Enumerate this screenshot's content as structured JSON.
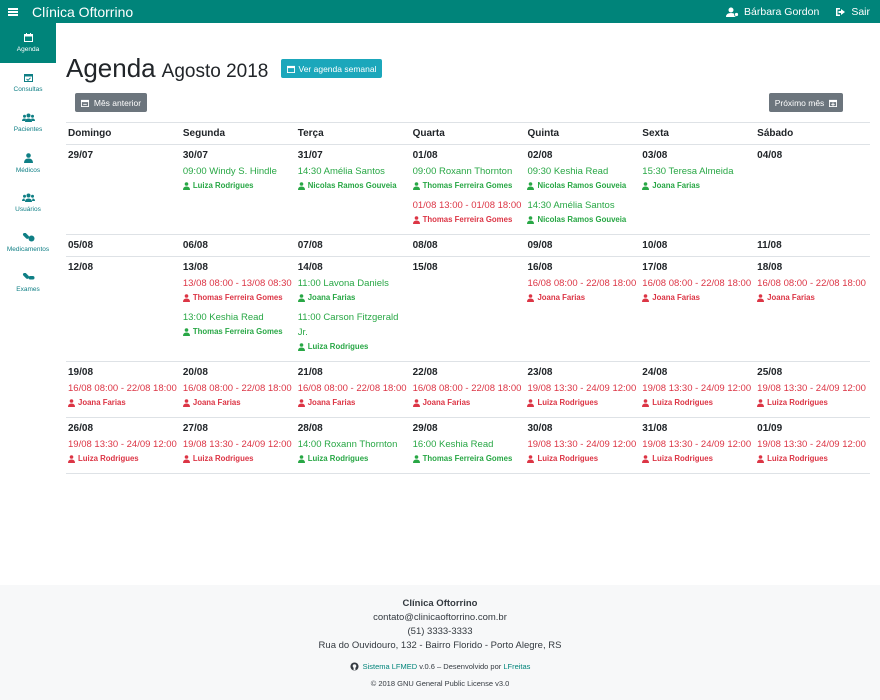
{
  "header": {
    "brand": "Clínica Oftorrino",
    "user": "Bárbara Gordon",
    "logout": "Sair"
  },
  "sidebar": {
    "items": [
      {
        "label": "Agenda",
        "icon": "calendar-icon",
        "active": true
      },
      {
        "label": "Consultas",
        "icon": "calendar-check-icon"
      },
      {
        "label": "Pacientes",
        "icon": "users-icon"
      },
      {
        "label": "Médicos",
        "icon": "doctor-icon"
      },
      {
        "label": "Usuários",
        "icon": "users-cog-icon"
      },
      {
        "label": "Medicamentos",
        "icon": "pills-icon"
      },
      {
        "label": "Exames",
        "icon": "capsules-icon"
      }
    ]
  },
  "page": {
    "title": "Agenda",
    "subtitle": "Agosto 2018",
    "week_button": "Ver agenda semanal",
    "prev_button": "Mês anterior",
    "next_button": "Próximo mês"
  },
  "calendar": {
    "days": [
      "Domingo",
      "Segunda",
      "Terça",
      "Quarta",
      "Quinta",
      "Sexta",
      "Sábado"
    ],
    "weeks": [
      [
        {
          "date": "29/07",
          "events": []
        },
        {
          "date": "30/07",
          "events": [
            {
              "text": "09:00 Windy S. Hindle",
              "doctor": "Luiza Rodrigues",
              "type": "green"
            }
          ]
        },
        {
          "date": "31/07",
          "events": [
            {
              "text": "14:30 Amélia Santos",
              "doctor": "Nicolas Ramos Gouveia",
              "type": "green"
            }
          ]
        },
        {
          "date": "01/08",
          "events": [
            {
              "text": "09:00 Roxann Thornton",
              "doctor": "Thomas Ferreira Gomes",
              "type": "green"
            },
            {
              "text": "01/08 13:00 - 01/08 18:00",
              "doctor": "Thomas Ferreira Gomes",
              "type": "red"
            }
          ]
        },
        {
          "date": "02/08",
          "events": [
            {
              "text": "09:30 Keshia Read",
              "doctor": "Nicolas Ramos Gouveia",
              "type": "green"
            },
            {
              "text": "14:30 Amélia Santos",
              "doctor": "Nicolas Ramos Gouveia",
              "type": "green"
            }
          ]
        },
        {
          "date": "03/08",
          "events": [
            {
              "text": "15:30 Teresa Almeida",
              "doctor": "Joana Farias",
              "type": "green"
            }
          ]
        },
        {
          "date": "04/08",
          "events": []
        }
      ],
      [
        {
          "date": "05/08",
          "events": []
        },
        {
          "date": "06/08",
          "events": []
        },
        {
          "date": "07/08",
          "events": []
        },
        {
          "date": "08/08",
          "events": []
        },
        {
          "date": "09/08",
          "events": []
        },
        {
          "date": "10/08",
          "events": []
        },
        {
          "date": "11/08",
          "events": []
        }
      ],
      [
        {
          "date": "12/08",
          "events": []
        },
        {
          "date": "13/08",
          "events": [
            {
              "text": "13/08 08:00 - 13/08 08:30",
              "doctor": "Thomas Ferreira Gomes",
              "type": "red"
            },
            {
              "text": "13:00 Keshia Read",
              "doctor": "Thomas Ferreira Gomes",
              "type": "green"
            }
          ]
        },
        {
          "date": "14/08",
          "events": [
            {
              "text": "11:00 Lavona Daniels",
              "doctor": "Joana Farias",
              "type": "green"
            },
            {
              "text": "11:00 Carson Fitzgerald Jr.",
              "doctor": "Luiza Rodrigues",
              "type": "green"
            }
          ]
        },
        {
          "date": "15/08",
          "events": []
        },
        {
          "date": "16/08",
          "events": [
            {
              "text": "16/08 08:00 - 22/08 18:00",
              "doctor": "Joana Farias",
              "type": "red"
            }
          ]
        },
        {
          "date": "17/08",
          "events": [
            {
              "text": "16/08 08:00 - 22/08 18:00",
              "doctor": "Joana Farias",
              "type": "red"
            }
          ]
        },
        {
          "date": "18/08",
          "events": [
            {
              "text": "16/08 08:00 - 22/08 18:00",
              "doctor": "Joana Farias",
              "type": "red"
            }
          ]
        }
      ],
      [
        {
          "date": "19/08",
          "events": [
            {
              "text": "16/08 08:00 - 22/08 18:00",
              "doctor": "Joana Farias",
              "type": "red"
            }
          ]
        },
        {
          "date": "20/08",
          "events": [
            {
              "text": "16/08 08:00 - 22/08 18:00",
              "doctor": "Joana Farias",
              "type": "red"
            }
          ]
        },
        {
          "date": "21/08",
          "events": [
            {
              "text": "16/08 08:00 - 22/08 18:00",
              "doctor": "Joana Farias",
              "type": "red"
            }
          ]
        },
        {
          "date": "22/08",
          "events": [
            {
              "text": "16/08 08:00 - 22/08 18:00",
              "doctor": "Joana Farias",
              "type": "red"
            }
          ]
        },
        {
          "date": "23/08",
          "events": [
            {
              "text": "19/08 13:30 - 24/09 12:00",
              "doctor": "Luiza Rodrigues",
              "type": "red"
            }
          ]
        },
        {
          "date": "24/08",
          "events": [
            {
              "text": "19/08 13:30 - 24/09 12:00",
              "doctor": "Luiza Rodrigues",
              "type": "red"
            }
          ]
        },
        {
          "date": "25/08",
          "events": [
            {
              "text": "19/08 13:30 - 24/09 12:00",
              "doctor": "Luiza Rodrigues",
              "type": "red"
            }
          ]
        }
      ],
      [
        {
          "date": "26/08",
          "events": [
            {
              "text": "19/08 13:30 - 24/09 12:00",
              "doctor": "Luiza Rodrigues",
              "type": "red"
            }
          ]
        },
        {
          "date": "27/08",
          "events": [
            {
              "text": "19/08 13:30 - 24/09 12:00",
              "doctor": "Luiza Rodrigues",
              "type": "red"
            }
          ]
        },
        {
          "date": "28/08",
          "events": [
            {
              "text": "14:00 Roxann Thornton",
              "doctor": "Luiza Rodrigues",
              "type": "green"
            }
          ]
        },
        {
          "date": "29/08",
          "events": [
            {
              "text": "16:00 Keshia Read",
              "doctor": "Thomas Ferreira Gomes",
              "type": "green"
            }
          ]
        },
        {
          "date": "30/08",
          "events": [
            {
              "text": "19/08 13:30 - 24/09 12:00",
              "doctor": "Luiza Rodrigues",
              "type": "red"
            }
          ]
        },
        {
          "date": "31/08",
          "events": [
            {
              "text": "19/08 13:30 - 24/09 12:00",
              "doctor": "Luiza Rodrigues",
              "type": "red"
            }
          ]
        },
        {
          "date": "01/09",
          "events": [
            {
              "text": "19/08 13:30 - 24/09 12:00",
              "doctor": "Luiza Rodrigues",
              "type": "red"
            }
          ]
        }
      ]
    ]
  },
  "footer": {
    "name": "Clínica Oftorrino",
    "email": "contato@clinicaoftorrino.com.br",
    "phone": "(51) 3333-3333",
    "address": "Rua do Ouvidouro, 132 - Bairro Florido - Porto Alegre, RS",
    "system_link": "Sistema LFMED",
    "version_text": " v.0.6 – Desenvolvido por ",
    "dev_link": "LFreitas",
    "license": "© 2018 GNU General Public License v3.0"
  },
  "colors": {
    "primary": "#00847a",
    "info": "#1ba7bb",
    "secondary": "#6c757d",
    "green": "#28a745",
    "red": "#dc3545"
  }
}
